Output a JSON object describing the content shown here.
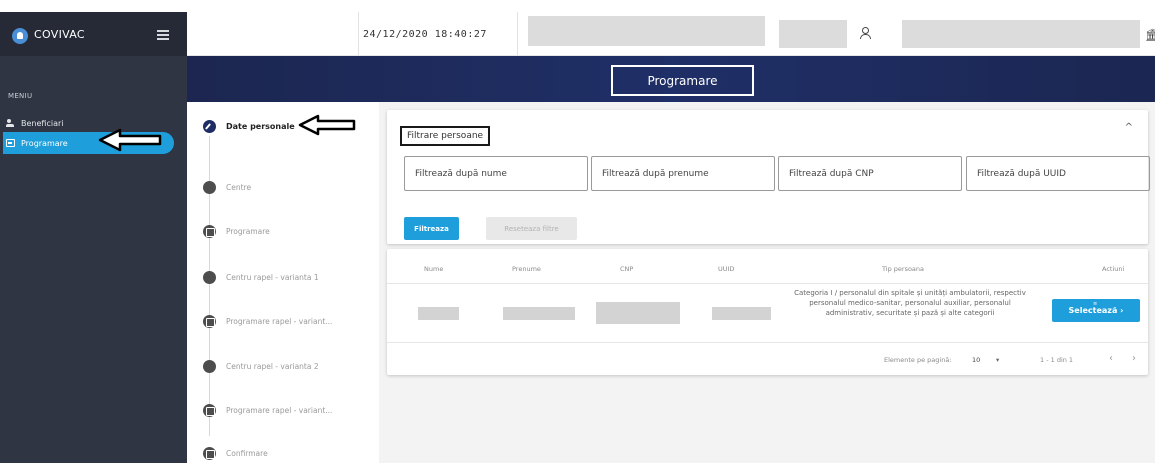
{
  "app": {
    "name": "COVIVAC"
  },
  "sidebar": {
    "menu_label": "MENIU",
    "items": [
      {
        "label": "Beneficiari",
        "icon": "users-icon",
        "active": false
      },
      {
        "label": "Programare",
        "icon": "calendar-icon",
        "active": true
      }
    ]
  },
  "header": {
    "datetime": "24/12/2020 18:40:27",
    "user_icon": "user-icon",
    "institution_icon": "bank-icon"
  },
  "band": {
    "title": "Programare"
  },
  "stepper": {
    "steps": [
      {
        "label": "Date personale",
        "state": "active"
      },
      {
        "label": "Centre",
        "state": "pending"
      },
      {
        "label": "Programare",
        "state": "pending"
      },
      {
        "label": "Centru rapel - varianta 1",
        "state": "pending"
      },
      {
        "label": "Programare rapel - variant...",
        "state": "pending"
      },
      {
        "label": "Centru rapel - varianta 2",
        "state": "pending"
      },
      {
        "label": "Programare rapel - variant...",
        "state": "pending"
      },
      {
        "label": "Confirmare",
        "state": "pending"
      }
    ]
  },
  "filter": {
    "title": "Filtrare persoane",
    "fields": [
      {
        "placeholder": "Filtrează după nume"
      },
      {
        "placeholder": "Filtrează după prenume"
      },
      {
        "placeholder": "Filtrează după CNP"
      },
      {
        "placeholder": "Filtrează după UUID"
      }
    ],
    "filter_button": "Filtreaza",
    "reset_button": "Reseteaza filtre"
  },
  "table": {
    "columns": [
      "Nume",
      "Prenume",
      "CNP",
      "UUID",
      "Tip persoana",
      "Actiuni"
    ],
    "rows": [
      {
        "tip_persoana": "Categoria I / personalul din spitale și unități ambulatorii, respectiv personalul medico-sanitar, personalul auxiliar, personalul administrativ, securitate și pază și alte categorii",
        "action": "Selectează ›"
      }
    ],
    "pagination": {
      "per_page_label": "Elemente pe pagină:",
      "per_page_value": "10",
      "range": "1 - 1 din 1"
    }
  },
  "colors": {
    "accent": "#1e9fdc",
    "sidebar": "#2f3543",
    "band": "#1f2f67"
  }
}
